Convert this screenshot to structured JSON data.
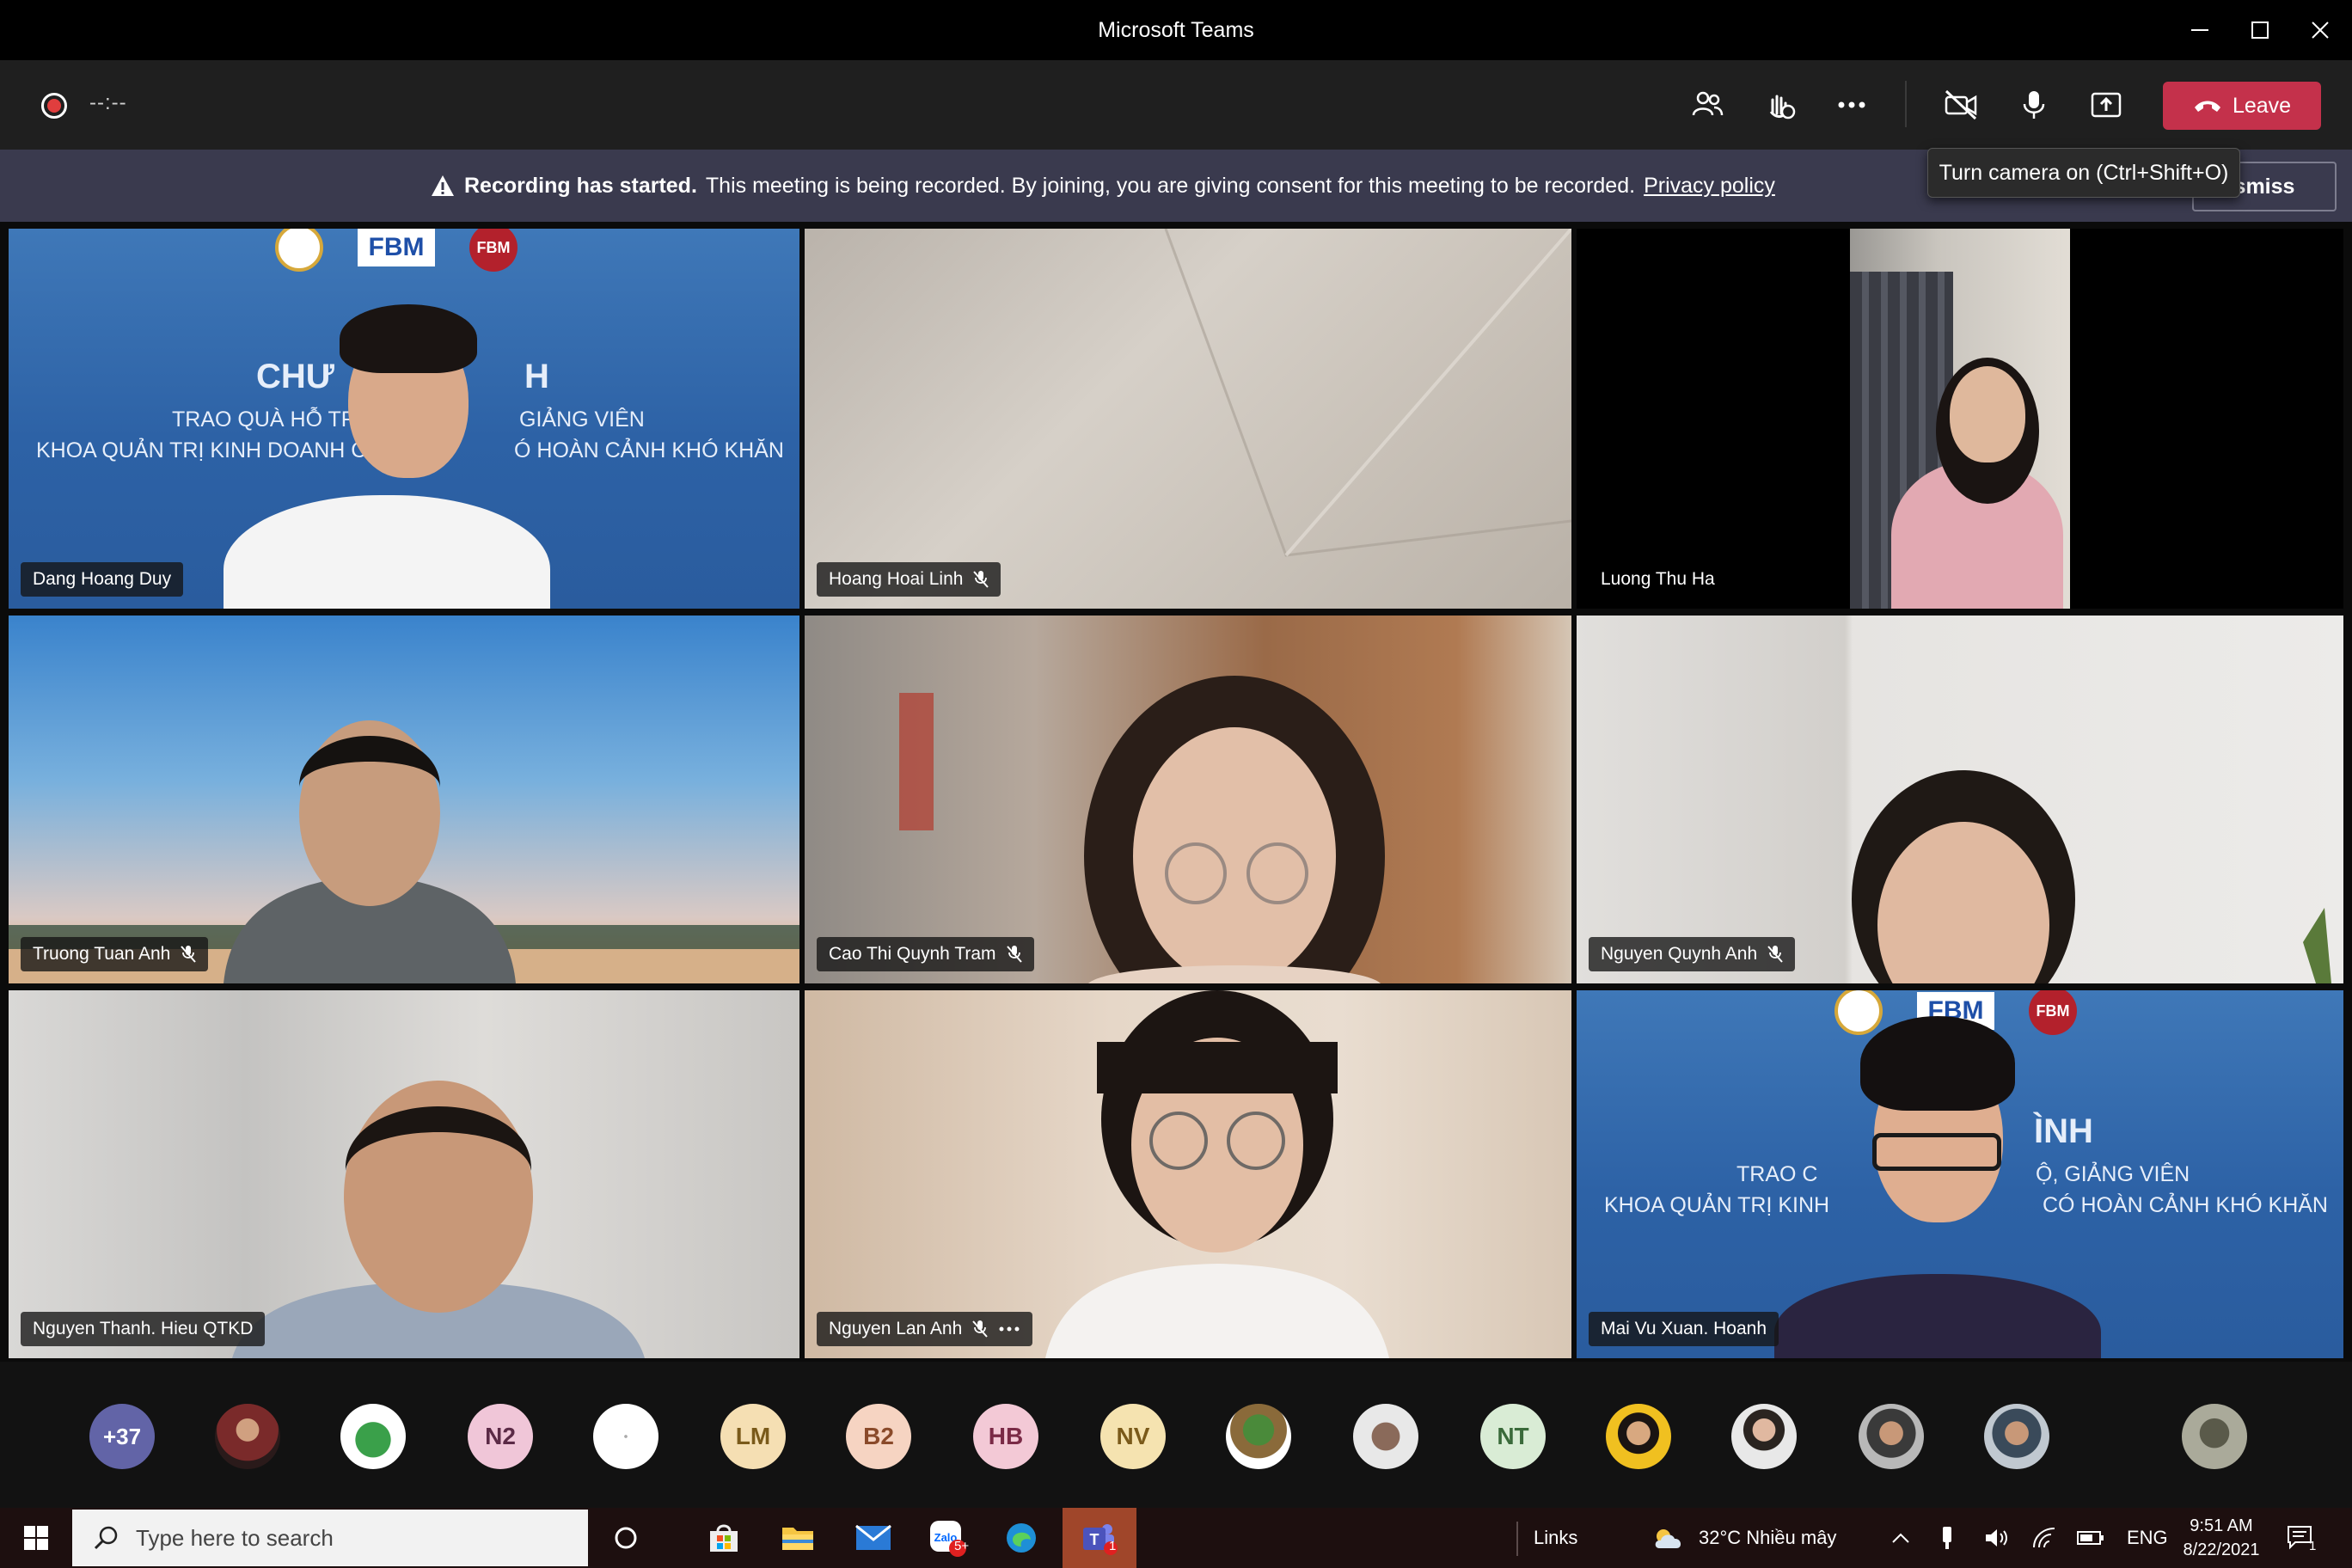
{
  "window": {
    "title": "Microsoft Teams"
  },
  "toolbar": {
    "timer": "--:--",
    "leave_label": "Leave",
    "tooltip": "Turn camera on (Ctrl+Shift+O)"
  },
  "banner": {
    "bold": "Recording has started.",
    "text": "This meeting is being recorded. By joining, you are giving consent for this meeting to be recorded.",
    "link": "Privacy policy",
    "dismiss_label": "smiss"
  },
  "slide": {
    "title_left": "CHƯ",
    "title_right": "H",
    "line1_left": "TRAO QUÀ HỖ TR",
    "line1_right": "GIẢNG VIÊN",
    "line2_left": "KHOA QUẢN TRỊ KINH DOANH C",
    "line2_right": "Ó HOÀN CẢNH KHÓ KHĂN",
    "title_b": "ÌNH",
    "line1_b_left": "TRAO C",
    "line1_b_right": "Ộ, GIẢNG VIÊN",
    "line2_b_left": "KHOA QUẢN TRỊ KINH",
    "line2_b_right": "CÓ HOÀN CẢNH KHÓ KHĂN",
    "logo_text": "FBM",
    "logo_text_small": "FBM"
  },
  "participants": [
    {
      "name": "Dang Hoang Duy",
      "muted": false
    },
    {
      "name": "Hoang Hoai Linh",
      "muted": true
    },
    {
      "name": "Luong Thu Ha",
      "muted": false
    },
    {
      "name": "Truong Tuan Anh",
      "muted": true
    },
    {
      "name": "Cao Thi Quynh Tram",
      "muted": true
    },
    {
      "name": "Nguyen Quynh Anh",
      "muted": true
    },
    {
      "name": "Nguyen Thanh. Hieu QTKD",
      "muted": false
    },
    {
      "name": "Nguyen Lan Anh",
      "muted": true
    },
    {
      "name": "Mai Vu Xuan. Hoanh",
      "muted": false
    }
  ],
  "strip": {
    "overflow": "+37",
    "initials": [
      "N2",
      "LM",
      "B2",
      "HB",
      "NV",
      "NT"
    ]
  },
  "taskbar": {
    "search_placeholder": "Type here to search",
    "links": "Links",
    "weather": "32°C  Nhiều mây",
    "lang": "ENG",
    "time": "9:51 AM",
    "date": "8/22/2021",
    "zalo_badge": "5+",
    "teams_badge": "1",
    "notif_badge": "1"
  },
  "colors": {
    "leave": "#c4314b",
    "banner": "#3a3a4e",
    "toolbar": "#1f1f1f"
  }
}
